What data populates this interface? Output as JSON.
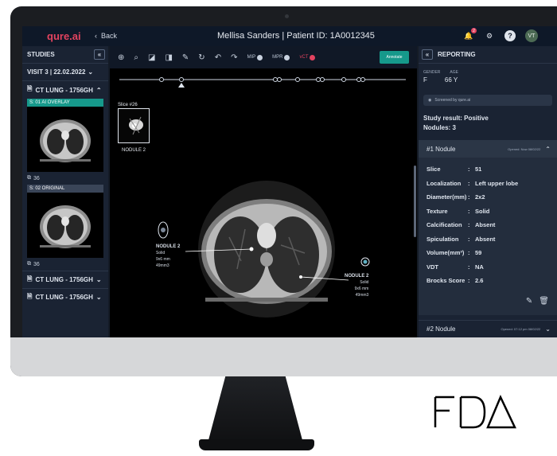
{
  "app": {
    "logo": "qure.ai",
    "back_label": "Back",
    "patient_title": "Mellisa Sanders | Patient ID: 1A0012345",
    "notification_count": "2",
    "avatar_initials": "VT",
    "accent": "#16998b",
    "brand": "#e2435f"
  },
  "studies": {
    "heading": "STUDIES",
    "collapse": "«",
    "visit": "VISIT 3 | 22.02.2022",
    "series_title": "CT LUNG - 1756GH",
    "thumbs": [
      {
        "label": "S: 01  AI OVERLAY",
        "count": "36"
      },
      {
        "label": "S: 02  ORIGINAL",
        "count": "36"
      }
    ],
    "collapsed_series": [
      "CT LUNG - 1756GH",
      "CT LUNG - 1756GH"
    ]
  },
  "toolbar": {
    "mip": "MIP",
    "mpr": "MPR",
    "vct": "vCT",
    "annotate": "Annotate"
  },
  "viewer": {
    "slice_label": "Slice #26",
    "crop_name": "NODULE 2",
    "nodule_left": {
      "name": "NODULE 2",
      "line1": "Solid",
      "line2": "9x6 mm",
      "line3": "49mm3"
    },
    "nodule_right": {
      "name": "NODULE 2",
      "line1": "Solid",
      "line2": "9x6 mm",
      "line3": "49mm3"
    }
  },
  "reporting": {
    "heading": "REPORTING",
    "collapse": "«",
    "gender_label": "GENDER",
    "age_label": "AGE",
    "gender": "F",
    "age": "66 Y",
    "screened": "Screened by qure.ai",
    "study_result": "Study result: Positive",
    "nodules": "Nodules: 3",
    "nodule1_title": "#1 Nodule",
    "nodule1_opened": "Opened: Now  08/02/22",
    "fields": [
      {
        "k": "Slice",
        "v": "51"
      },
      {
        "k": "Localization",
        "v": "Left upper lobe"
      },
      {
        "k": "Diameter(mm)",
        "v": "2x2"
      },
      {
        "k": "Texture",
        "v": "Solid"
      },
      {
        "k": "Calcification",
        "v": "Absent"
      },
      {
        "k": "Spiculation",
        "v": "Absent"
      },
      {
        "k": "Volume(mm³)",
        "v": "59"
      },
      {
        "k": "VDT",
        "v": "NA"
      },
      {
        "k": "Brocks Score",
        "v": "2.6"
      }
    ],
    "nodule2_title": "#2 Nodule",
    "nodule2_opened": "Opened: 07:12 pm  08/02/22"
  },
  "fda_logo": "FDA"
}
